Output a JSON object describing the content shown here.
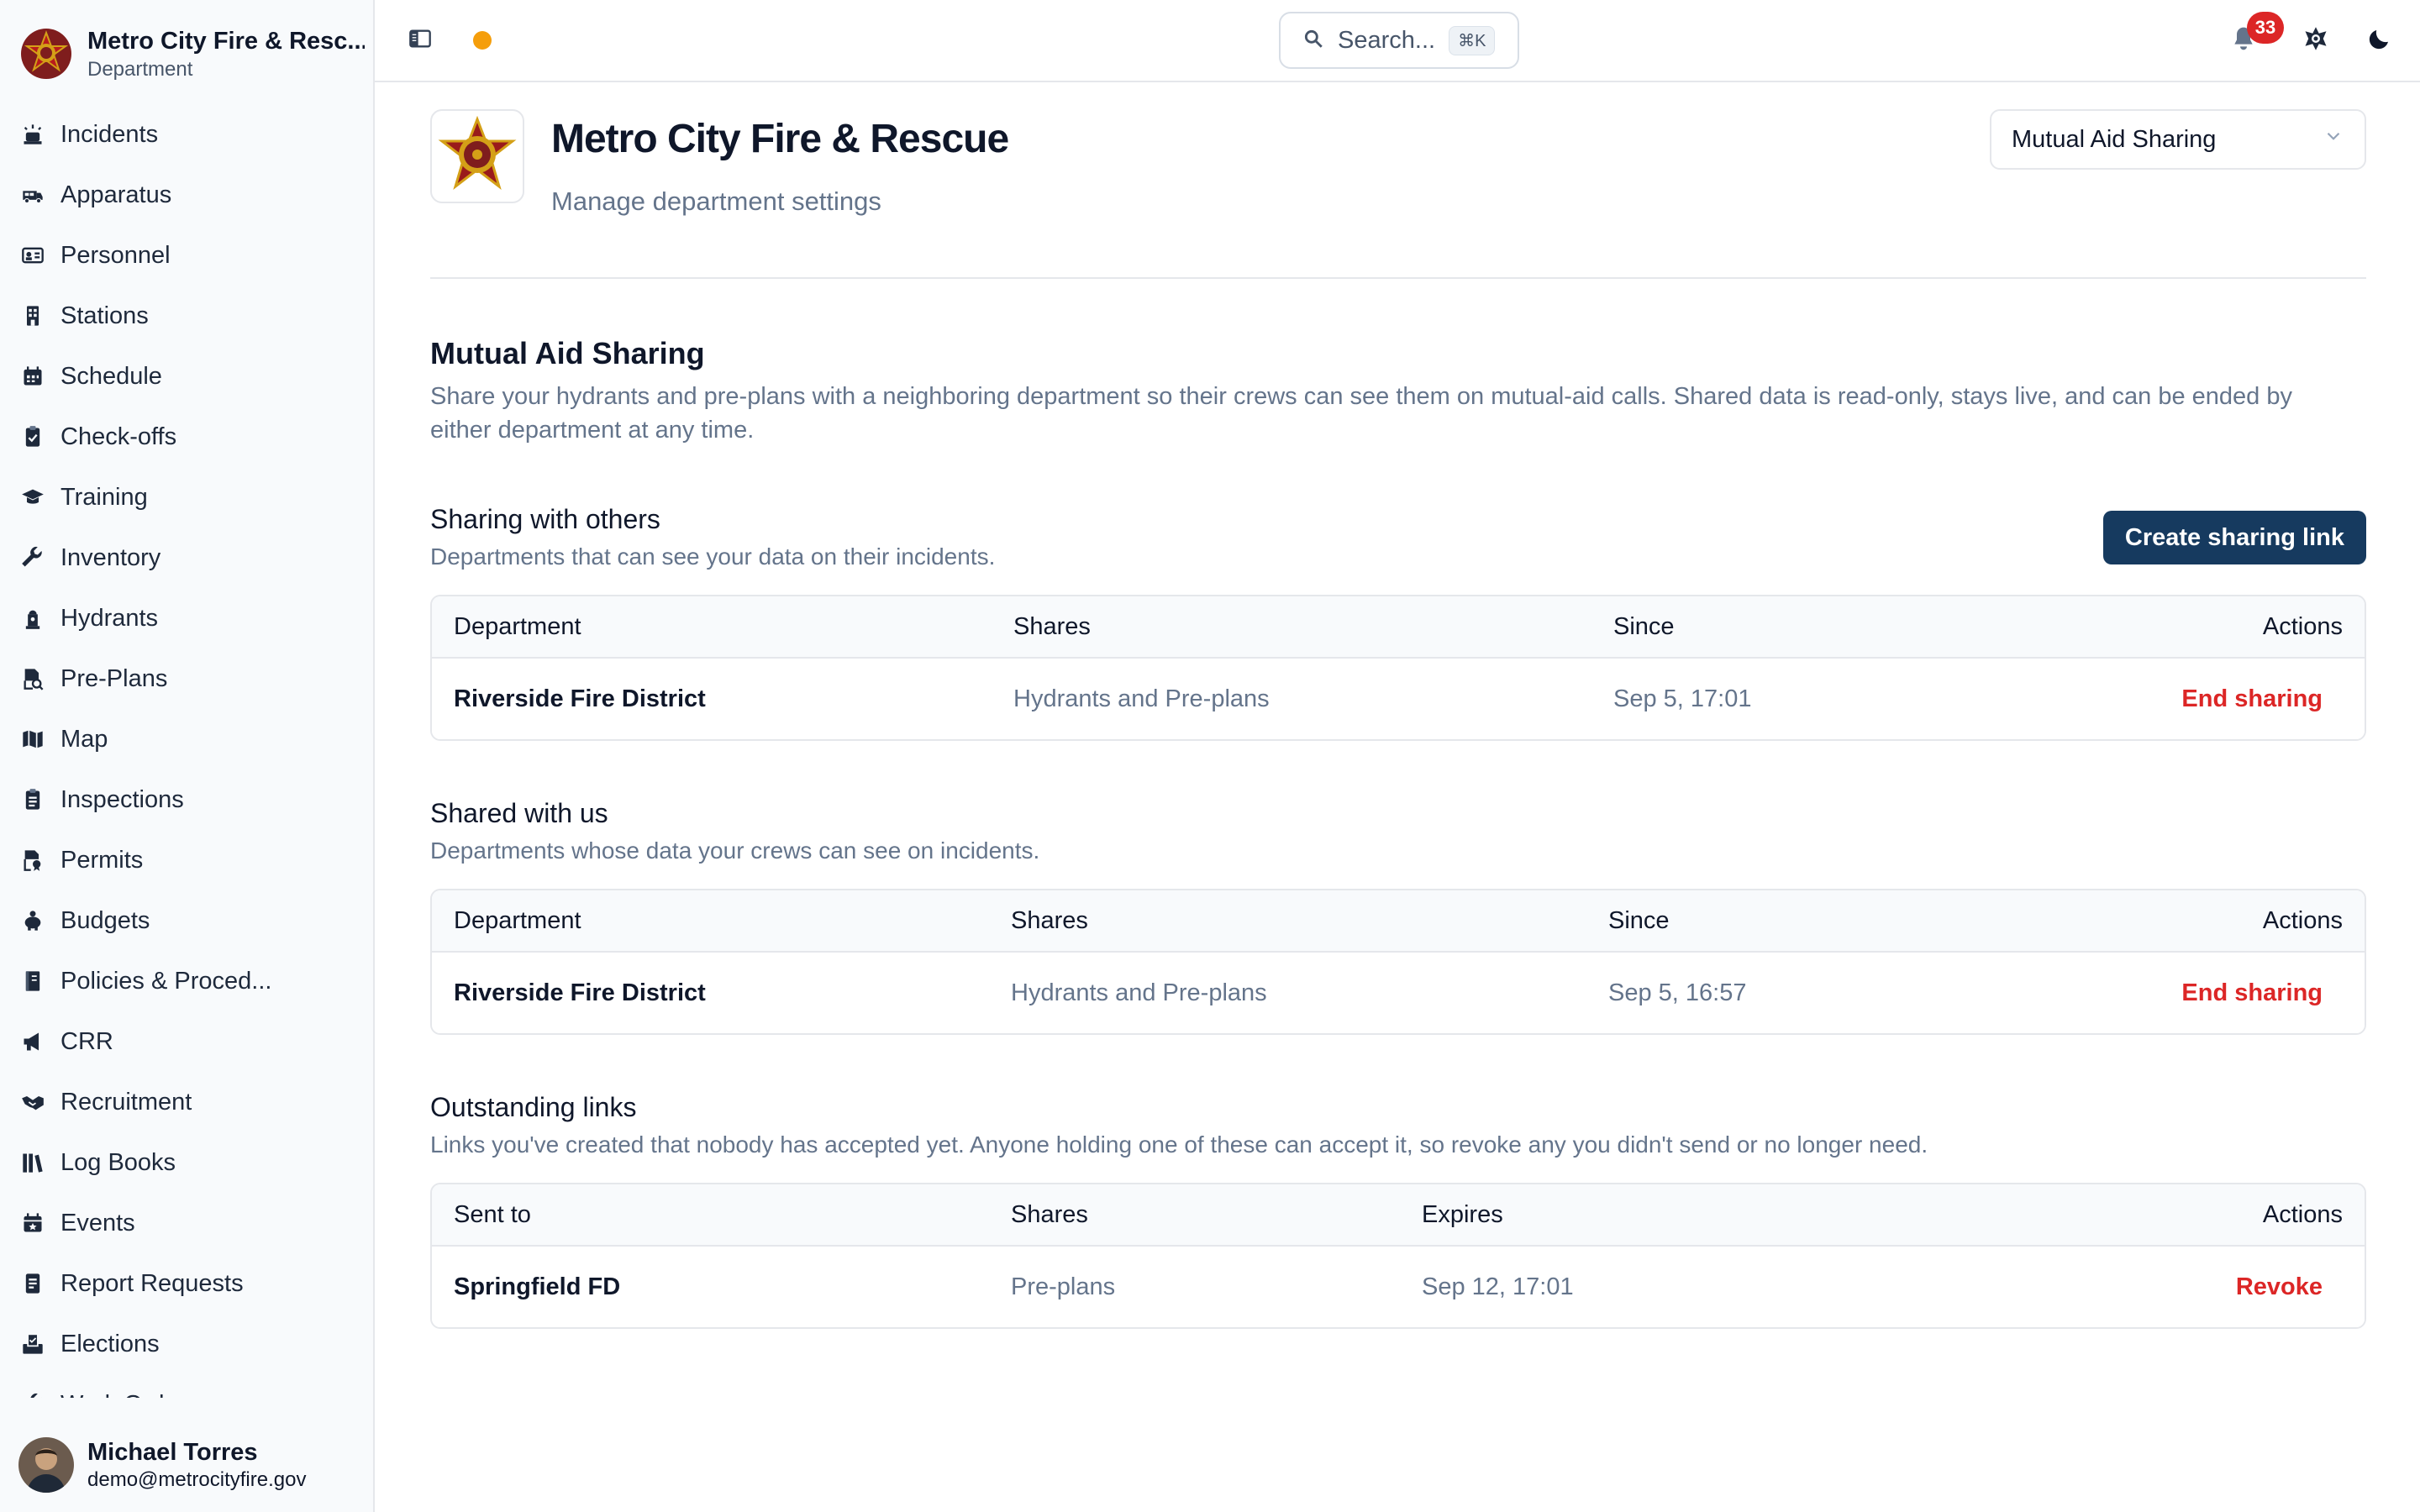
{
  "sidebar": {
    "org_name": "Metro City Fire & Resc...",
    "org_sub": "Department",
    "items": [
      {
        "label": "Incidents",
        "icon": "alarm-light-icon"
      },
      {
        "label": "Apparatus",
        "icon": "fire-truck-icon"
      },
      {
        "label": "Personnel",
        "icon": "id-card-icon"
      },
      {
        "label": "Stations",
        "icon": "building-icon"
      },
      {
        "label": "Schedule",
        "icon": "calendar-icon"
      },
      {
        "label": "Check-offs",
        "icon": "clipboard-check-icon"
      },
      {
        "label": "Training",
        "icon": "graduation-cap-icon"
      },
      {
        "label": "Inventory",
        "icon": "wrench-icon"
      },
      {
        "label": "Hydrants",
        "icon": "hydrant-icon"
      },
      {
        "label": "Pre-Plans",
        "icon": "document-search-icon"
      },
      {
        "label": "Map",
        "icon": "map-icon"
      },
      {
        "label": "Inspections",
        "icon": "clipboard-list-icon"
      },
      {
        "label": "Permits",
        "icon": "permit-icon"
      },
      {
        "label": "Budgets",
        "icon": "piggy-bank-icon"
      },
      {
        "label": "Policies & Proced...",
        "icon": "book-icon"
      },
      {
        "label": "CRR",
        "icon": "megaphone-icon"
      },
      {
        "label": "Recruitment",
        "icon": "handshake-icon"
      },
      {
        "label": "Log Books",
        "icon": "books-icon"
      },
      {
        "label": "Events",
        "icon": "calendar-event-icon"
      },
      {
        "label": "Report Requests",
        "icon": "report-icon"
      },
      {
        "label": "Elections",
        "icon": "ballot-box-icon"
      },
      {
        "label": "Work Orders",
        "icon": "tools-icon"
      }
    ],
    "user": {
      "name": "Michael Torres",
      "email": "demo@metrocityfire.gov"
    }
  },
  "topbar": {
    "search_placeholder": "Search...",
    "search_shortcut": "⌘K",
    "notification_count": "33",
    "status_color": "#f59e0b"
  },
  "header": {
    "title": "Metro City Fire & Rescue",
    "subtitle": "Manage department settings",
    "section_select": "Mutual Aid Sharing"
  },
  "mutual_aid": {
    "title": "Mutual Aid Sharing",
    "description": "Share your hydrants and pre-plans with a neighboring department so their crews can see them on mutual-aid calls. Shared data is read-only, stays live, and can be ended by either department at any time."
  },
  "sharing_with_others": {
    "title": "Sharing with others",
    "description": "Departments that can see your data on their incidents.",
    "button": "Create sharing link",
    "columns": [
      "Department",
      "Shares",
      "Since",
      "Actions"
    ],
    "rows": [
      {
        "department": "Riverside Fire District",
        "shares": "Hydrants and Pre-plans",
        "since": "Sep 5, 17:01",
        "action": "End sharing"
      }
    ]
  },
  "shared_with_us": {
    "title": "Shared with us",
    "description": "Departments whose data your crews can see on incidents.",
    "columns": [
      "Department",
      "Shares",
      "Since",
      "Actions"
    ],
    "rows": [
      {
        "department": "Riverside Fire District",
        "shares": "Hydrants and Pre-plans",
        "since": "Sep 5, 16:57",
        "action": "End sharing"
      }
    ]
  },
  "outstanding_links": {
    "title": "Outstanding links",
    "description": "Links you've created that nobody has accepted yet. Anyone holding one of these can accept it, so revoke any you didn't send or no longer need.",
    "columns": [
      "Sent to",
      "Shares",
      "Expires",
      "Actions"
    ],
    "rows": [
      {
        "sent_to": "Springfield FD",
        "shares": "Pre-plans",
        "expires": "Sep 12, 17:01",
        "action": "Revoke"
      }
    ]
  },
  "colors": {
    "primary": "#163a5f",
    "danger": "#dc2626",
    "muted_text": "#64748b",
    "border": "#e5e7eb"
  }
}
